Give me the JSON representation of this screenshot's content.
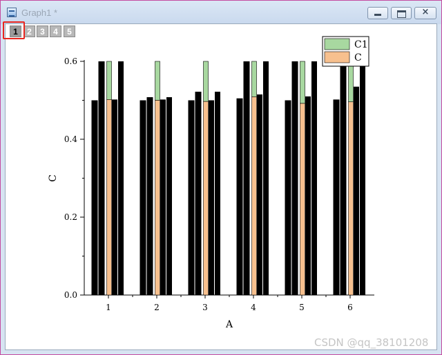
{
  "window": {
    "title": "Graph1 *",
    "icon": "graph-window-icon",
    "buttons": {
      "minimize": "minimize-icon",
      "maximize": "maximize-icon",
      "close": "×"
    }
  },
  "layer_tabs": [
    "1",
    "2",
    "3",
    "4",
    "5"
  ],
  "active_layer": "1",
  "watermark": "CSDN @qq_38101208",
  "chart_data": {
    "type": "bar",
    "xlabel": "A",
    "ylabel": "C",
    "categories": [
      "1",
      "2",
      "3",
      "4",
      "5",
      "6"
    ],
    "ylim": [
      0,
      0.6
    ],
    "yticks": [
      "0.0",
      "0.2",
      "0.4",
      "0.6"
    ],
    "series": [
      {
        "name": "C1",
        "color": "#a8d8a0",
        "values": [
          0.6,
          0.6,
          0.6,
          0.6,
          0.6,
          0.6
        ]
      },
      {
        "name": "C",
        "color": "#f7c08e",
        "values": [
          0.502,
          0.5,
          0.497,
          0.509,
          0.492,
          0.496
        ]
      }
    ],
    "other_bars_color": "#000000",
    "other_bars": [
      [
        0.5,
        0.6,
        0.502,
        0.6
      ],
      [
        0.5,
        0.508,
        0.502,
        0.508
      ],
      [
        0.5,
        0.522,
        0.5,
        0.522
      ],
      [
        0.505,
        0.6,
        0.515,
        0.6
      ],
      [
        0.5,
        0.6,
        0.51,
        0.6
      ],
      [
        0.502,
        0.6,
        0.535,
        0.6
      ]
    ],
    "legend": {
      "position": "top-right",
      "entries": [
        "C1",
        "C"
      ]
    },
    "grid": false
  }
}
